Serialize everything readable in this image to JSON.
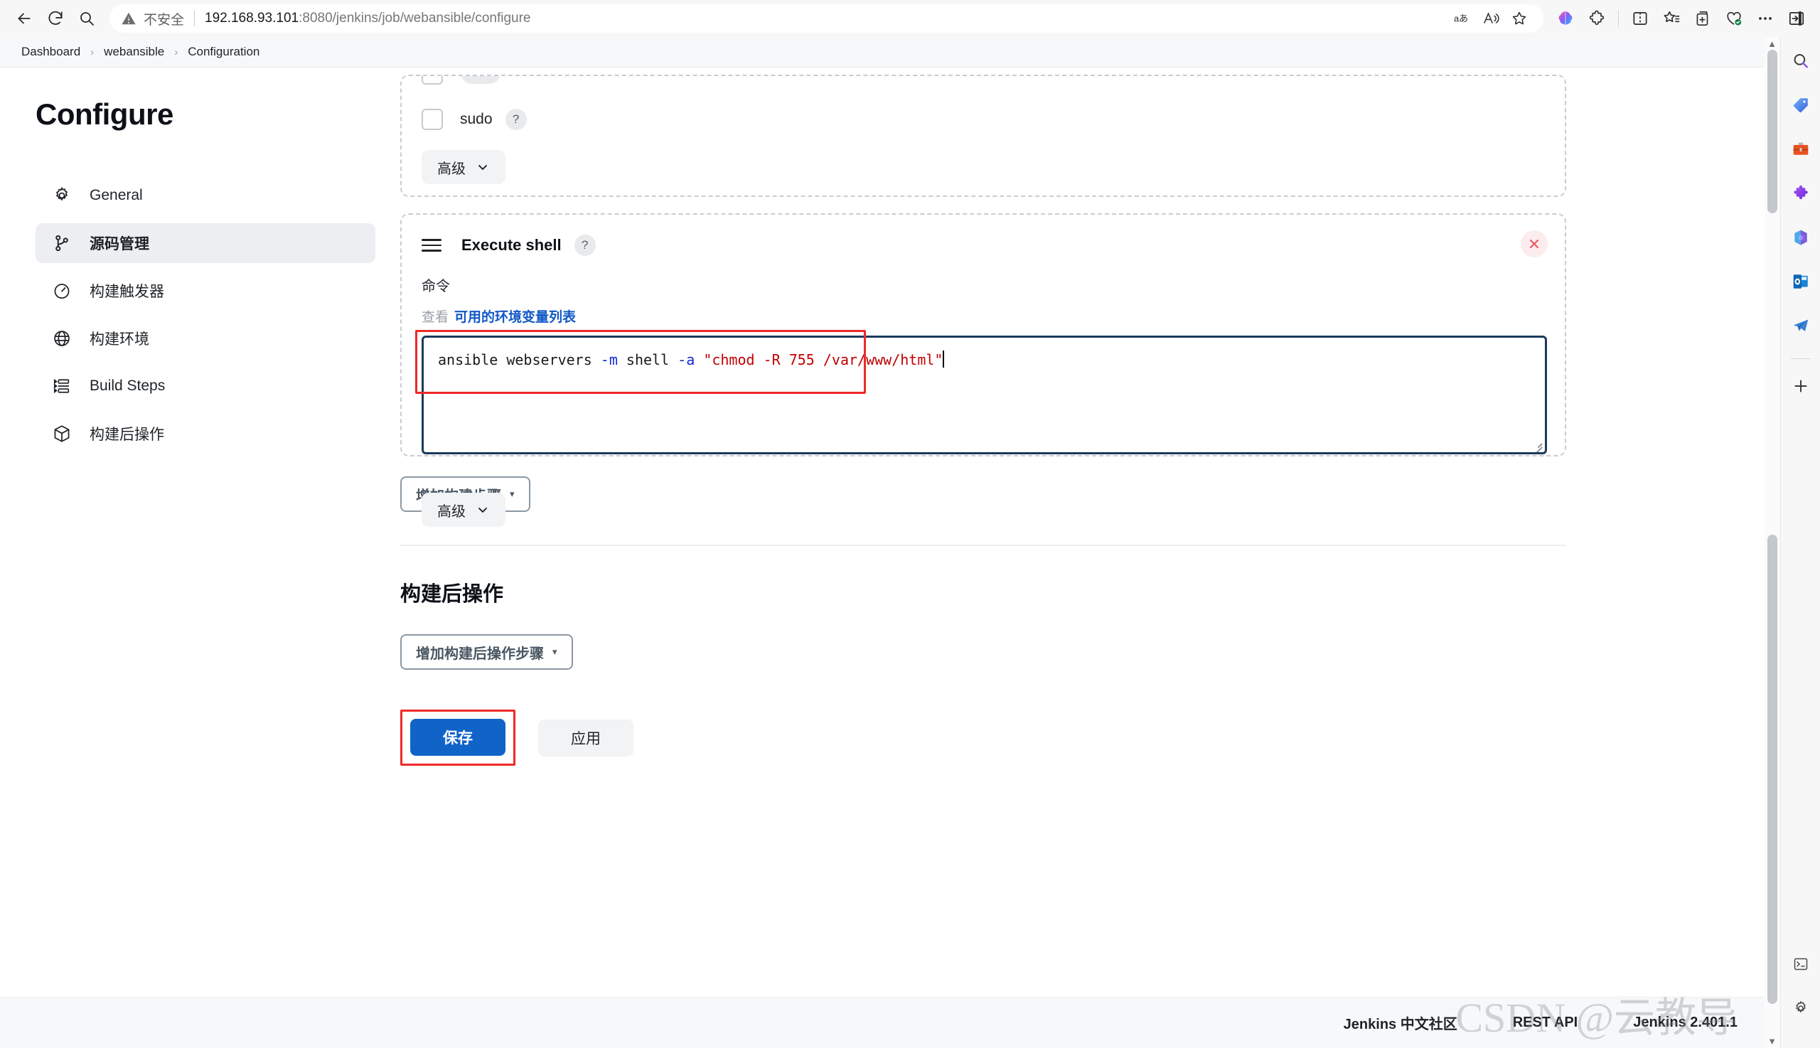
{
  "browser": {
    "back_label": "Back",
    "reload_label": "Reload",
    "search_label": "Search",
    "security_label": "不安全",
    "url_host": "192.168.93.101",
    "url_path": ":8080/jenkins/job/webansible/configure",
    "omnibox_icons": [
      {
        "name": "translate-icon",
        "glyph": "aあ"
      },
      {
        "name": "read-aloud-icon",
        "glyph": "A"
      },
      {
        "name": "favorite-star-icon",
        "glyph": "☆"
      }
    ],
    "toolbar_icons": [
      {
        "name": "copilot-icon"
      },
      {
        "name": "extensions-puzzle-icon"
      },
      {
        "name": "split-screen-icon"
      },
      {
        "name": "favorites-list-icon"
      },
      {
        "name": "collections-icon"
      },
      {
        "name": "browser-essentials-icon"
      },
      {
        "name": "more-options-icon"
      },
      {
        "name": "sidebar-toggle-icon"
      }
    ],
    "sidebar_icons": [
      {
        "name": "search-icon"
      },
      {
        "name": "shopping-tag-icon"
      },
      {
        "name": "tools-icon"
      },
      {
        "name": "extensions-icon"
      },
      {
        "name": "office-icon"
      },
      {
        "name": "outlook-icon"
      },
      {
        "name": "telegram-icon"
      },
      {
        "name": "add-sidebar-app-icon",
        "glyph": "+"
      },
      {
        "name": "discover-icon"
      },
      {
        "name": "sidebar-settings-icon"
      }
    ]
  },
  "breadcrumb": {
    "items": [
      "Dashboard",
      "webansible",
      "Configuration"
    ],
    "separator": "›"
  },
  "nav": {
    "title": "Configure",
    "items": [
      {
        "label": "General",
        "icon": "gear-icon",
        "active": false
      },
      {
        "label": "源码管理",
        "icon": "source-branch-icon",
        "active": true
      },
      {
        "label": "构建触发器",
        "icon": "clock-icon",
        "active": false
      },
      {
        "label": "构建环境",
        "icon": "globe-icon",
        "active": false
      },
      {
        "label": "Build Steps",
        "icon": "steps-list-icon",
        "active": false
      },
      {
        "label": "构建后操作",
        "icon": "package-icon",
        "active": false
      }
    ]
  },
  "sudo_block": {
    "checkbox_label": "sudo",
    "help_glyph": "?",
    "advanced_label": "高级",
    "chevron": "⌄"
  },
  "shell_block": {
    "drag_handle": "drag-handle-icon",
    "title": "Execute shell",
    "help_glyph": "?",
    "close_glyph": "✕",
    "command_label": "命令",
    "env_prefix": "查看",
    "env_link": "可用的环境变量列表",
    "command_parts": {
      "p1": "ansible webservers ",
      "flag1": "-m",
      "p2": " shell ",
      "flag2": "-a",
      "p3": " ",
      "quoted": "\"chmod -R 755 /var/www/html\""
    },
    "command_full": "ansible webservers -m shell -a \"chmod -R 755 /var/www/html\"",
    "advanced_label": "高级",
    "chevron": "⌄"
  },
  "actions": {
    "add_build_step": "增加构建步骤",
    "post_build_heading": "构建后操作",
    "add_post_build_step": "增加构建后操作步骤",
    "caret": "▾",
    "save": "保存",
    "apply": "应用"
  },
  "footer": {
    "community": "Jenkins 中文社区",
    "rest_api": "REST API",
    "version": "Jenkins 2.401.1",
    "watermark": "CSDN @云教导"
  },
  "colors": {
    "accent_blue": "#1064c8",
    "link_blue": "#1158c7",
    "highlight_red": "#ef2929",
    "focus_border": "#1b3a5c",
    "string_red": "#c00000",
    "flag_blue": "#1028d8",
    "active_nav_bg": "#eceef2"
  }
}
